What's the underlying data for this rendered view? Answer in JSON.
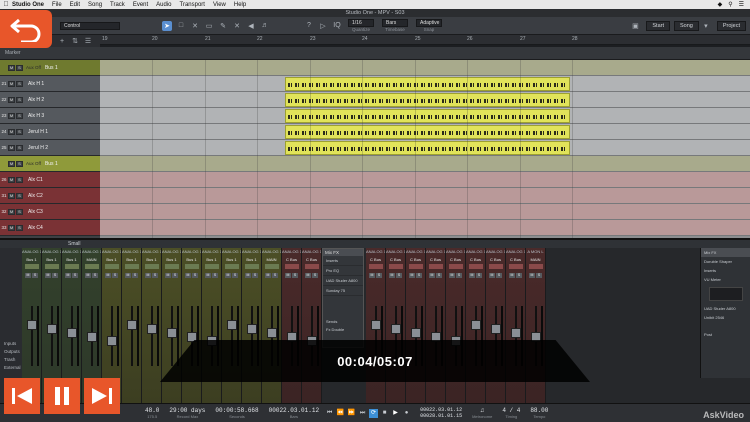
{
  "menubar": {
    "app": "Studio One",
    "items": [
      "File",
      "Edit",
      "Song",
      "Track",
      "Event",
      "Audio",
      "Transport",
      "View",
      "Help"
    ]
  },
  "window_title": "Studio One - MPV - S03",
  "toolbar": {
    "control_label": "Control",
    "quantize_value": "1/16",
    "quantize_label": "Quantize",
    "timebase_value": "Bars",
    "timebase_label": "Timebase",
    "snap_value": "Adaptive",
    "snap_label": "Snap",
    "start": "Start",
    "song": "Song",
    "project": "Project"
  },
  "ruler": {
    "ticks": [
      "19",
      "20",
      "21",
      "22",
      "23",
      "24",
      "25",
      "26",
      "27",
      "28"
    ]
  },
  "marker_label": "Marker",
  "tracks": [
    {
      "num": "",
      "name": "Bus 1",
      "sub": "Aux Off",
      "type": "folder"
    },
    {
      "num": "21",
      "name": "Alx H 1",
      "type": "track"
    },
    {
      "num": "22",
      "name": "Alx H 2",
      "type": "track"
    },
    {
      "num": "23",
      "name": "Alx H 3",
      "type": "track"
    },
    {
      "num": "24",
      "name": "Jerul H 1",
      "type": "track"
    },
    {
      "num": "25",
      "name": "Jerul H 2",
      "type": "track"
    },
    {
      "num": "",
      "name": "Bus 1",
      "sub": "Aux Off",
      "type": "folder"
    },
    {
      "num": "26",
      "name": "Alx C1",
      "type": "track-red"
    },
    {
      "num": "31",
      "name": "Alx C2",
      "type": "track-red"
    },
    {
      "num": "32",
      "name": "Alx C3",
      "type": "track-red"
    },
    {
      "num": "33",
      "name": "Alx C4",
      "type": "track-red"
    }
  ],
  "track_labels": {
    "volume": "Volume",
    "m": "M",
    "s": "S"
  },
  "mixer": {
    "zoom_label": "Small",
    "left_items": [
      "Inputs",
      "Outputs",
      "Trash",
      "External"
    ],
    "fx_panel": {
      "title": "Mix FX",
      "items": [
        "Inserts",
        "Pro EQ",
        "UAD Studer A800",
        "Sunday 75"
      ],
      "sends": [
        "Sends",
        "Fx Double"
      ]
    },
    "right_panel": {
      "title": "Mix FX",
      "items": [
        "Doruble Shaper",
        "Inserts",
        "VU Meter",
        "UAD Studer A800",
        "Unibit 2546",
        "Post"
      ]
    },
    "channels": [
      {
        "in": "ANALOG 1",
        "out": "Bus 1",
        "color": "green"
      },
      {
        "in": "ANALOG 1",
        "out": "Bus 1",
        "color": "green"
      },
      {
        "in": "ANALOG 1",
        "out": "Bus 1",
        "color": "green"
      },
      {
        "in": "ANALOG 1",
        "out": "MAIN",
        "color": "green"
      },
      {
        "in": "ANALOG 1",
        "out": "Bus 1",
        "color": "olive"
      },
      {
        "in": "ANALOG 1",
        "out": "Bus 1",
        "color": "olive"
      },
      {
        "in": "ANALOG 1",
        "out": "Bus 1",
        "color": "olive"
      },
      {
        "in": "ANALOG 1",
        "out": "Bus 1",
        "color": "olive"
      },
      {
        "in": "ANALOG 1",
        "out": "Bus 1",
        "color": "olive"
      },
      {
        "in": "ANALOG 1",
        "out": "Bus 1",
        "color": "olive"
      },
      {
        "in": "ANALOG 1",
        "out": "Bus 1",
        "color": "olive"
      },
      {
        "in": "ANALOG 1",
        "out": "Bus 1",
        "color": "olive"
      },
      {
        "in": "ANALOG 1",
        "out": "MAIN",
        "color": "olive"
      },
      {
        "in": "ANALOG 1",
        "out": "C Bus",
        "color": "red"
      },
      {
        "in": "ANALOG 1",
        "out": "C Bus",
        "color": "red"
      },
      {
        "in": "ANALOG 1",
        "out": "C Bus",
        "color": "red"
      },
      {
        "in": "ANALOG 1",
        "out": "C Bus",
        "color": "red"
      },
      {
        "in": "ANALOG 1",
        "out": "C Bus",
        "color": "red"
      },
      {
        "in": "ANALOG 1",
        "out": "C Bus",
        "color": "red"
      },
      {
        "in": "ANALOG 1",
        "out": "C Bus",
        "color": "red"
      },
      {
        "in": "ANALOG 1",
        "out": "C Bus",
        "color": "red"
      },
      {
        "in": "ANALOG 1",
        "out": "C Bus",
        "color": "red"
      },
      {
        "in": "ANALOG 1",
        "out": "C Bus",
        "color": "red"
      },
      {
        "in": "A MON L",
        "out": "MAIN",
        "color": "red"
      }
    ]
  },
  "transport": {
    "record_max": "48.0",
    "record_max_sub": "175.5",
    "days": "29:00 days",
    "days_label": "Record Max",
    "seconds": "00:00:58.668",
    "seconds_label": "Seconds",
    "bars": "00022.03.01.12",
    "bars_label": "Bars",
    "loop_start": "00022.03.01.12",
    "loop_end": "00028.01.01.15",
    "metronome_label": "Metronome",
    "timing": "4 / 4",
    "timing_label": "Timing",
    "tempo": "88.00",
    "tempo_label": "Tempo"
  },
  "video": {
    "time": "00:04/05:07",
    "watermark": "AskVideo"
  },
  "colors": {
    "accent": "#e8562a",
    "clip": "#e1e35a",
    "folder_olive": "#6f7a2f",
    "folder_red": "#7a3235"
  }
}
